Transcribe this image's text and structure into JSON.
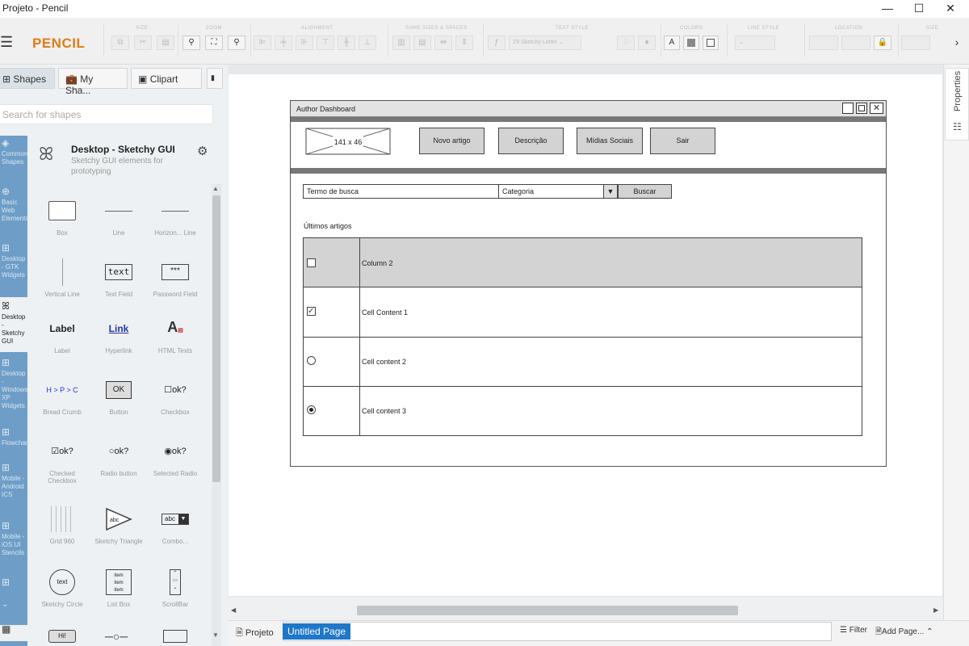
{
  "window": {
    "title": "Projeto - Pencil",
    "min": "—",
    "max": "☐",
    "close": "✕"
  },
  "app": {
    "logo": "PENCIL",
    "menu_icon": "hamburger-icon"
  },
  "toolbar": {
    "groups": [
      "SIZE",
      "ZOOM",
      "ALIGNMENT",
      "SAME SIZES & SPACES",
      "TEXT STYLE",
      "COLORS",
      "LINE STYLE",
      "LOCATION",
      "SIZE"
    ],
    "font_value": "Z9 Sketchy Letter",
    "color_label": "A"
  },
  "left_panel": {
    "tabs": [
      "Shapes",
      "My Sha...",
      "Clipart"
    ],
    "search_placeholder": "Search for shapes",
    "categories": [
      {
        "label": "Common Shapes"
      },
      {
        "label": "Basic Web Elements"
      },
      {
        "label": "Desktop - GTK Widgets"
      },
      {
        "label": "Desktop - Sketchy GUI"
      },
      {
        "label": "Desktop - Windows XP Widgets"
      },
      {
        "label": "Flowchart"
      },
      {
        "label": "Mobile - Android ICS"
      },
      {
        "label": "Mobile - iOS UI Stencils"
      }
    ],
    "collection": {
      "name": "Desktop - Sketchy GUI",
      "description": "Sketchy GUI elements for prototyping"
    },
    "shapes": [
      [
        "Box",
        "Line",
        "Horizon... Line"
      ],
      [
        "Vertical Line",
        "Text Field",
        "Password Field"
      ],
      [
        "Label",
        "Hyperlink",
        "HTML Texts"
      ],
      [
        "Bread Crumb",
        "Button",
        "Checkbox"
      ],
      [
        "Checked Checkbox",
        "Radio button",
        "Selected Radio"
      ],
      [
        "Grid 960",
        "Sketchy Triangle",
        "Combo..."
      ],
      [
        "Sketchy Circle",
        "List Box",
        "ScrollBar"
      ]
    ],
    "shape_texts": {
      "text": "text",
      "password": "***",
      "label": "Label",
      "link": "Link",
      "button": "OK",
      "ok": "ok?",
      "breadcrumb": "H > P > C",
      "combo": "abc",
      "circle": "text",
      "listbox": "item",
      "hi": "Hi!"
    }
  },
  "right_panel": {
    "label": "Properties"
  },
  "mockup": {
    "window_title": "Author Dashboard",
    "image_placeholder": "141 x 46",
    "nav_buttons": [
      "Novo artigo",
      "Descrição",
      "Mídias Sociais",
      "Sair"
    ],
    "search_value": "Termo de busca",
    "category_value": "Categoria",
    "search_button": "Buscar",
    "section_label": "Últimos artigos",
    "table": {
      "header": "Column 2",
      "rows": [
        {
          "control": "checkbox-checked",
          "text": "Cell Content 1"
        },
        {
          "control": "radio",
          "text": "Cell content 2"
        },
        {
          "control": "radio-selected",
          "text": "Cell content 3"
        }
      ]
    }
  },
  "bottom": {
    "project_label": "Projeto",
    "page_tab": "Untitled Page",
    "filter": "Filter",
    "add_page": "Add Page..."
  }
}
